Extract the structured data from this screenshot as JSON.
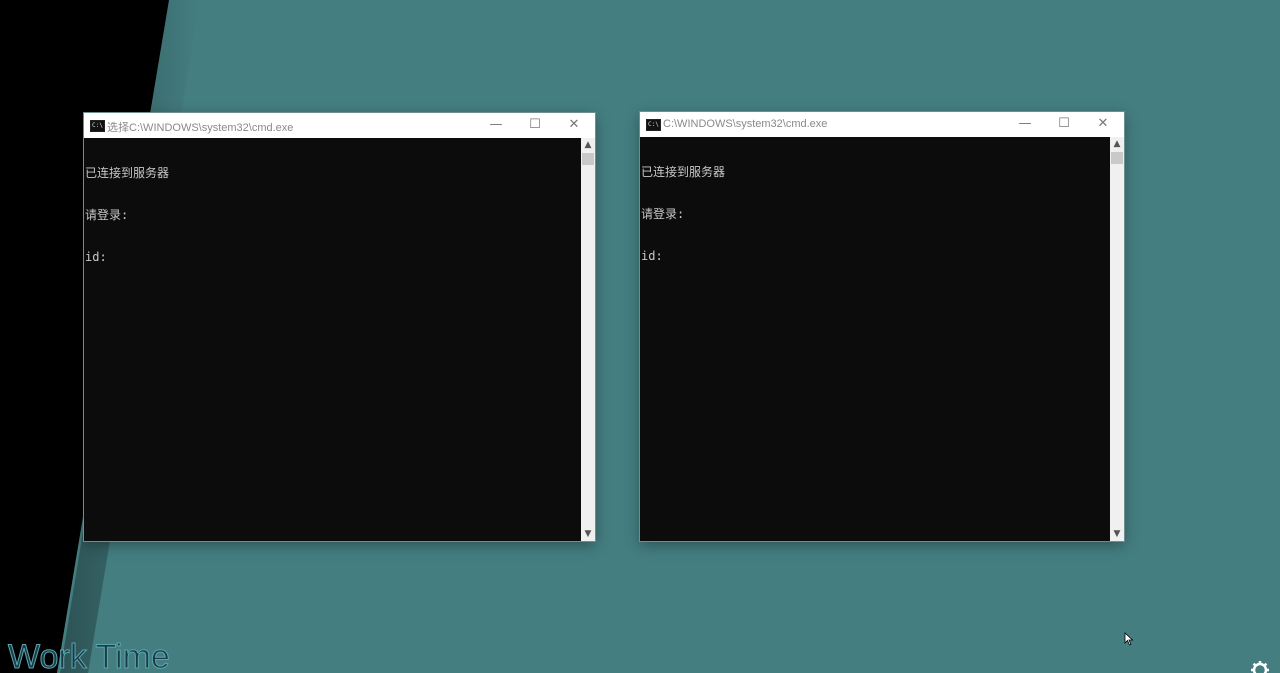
{
  "desktop": {
    "watermark_text": "Work Time",
    "background_color": "#447e81"
  },
  "windows": [
    {
      "title": "选择C:\\WINDOWS\\system32\\cmd.exe",
      "lines": [
        "已连接到服务器",
        "请登录:",
        "id:"
      ]
    },
    {
      "title": "C:\\WINDOWS\\system32\\cmd.exe",
      "lines": [
        "已连接到服务器",
        "请登录:",
        "id:"
      ]
    }
  ],
  "titlebar_buttons": {
    "minimize": "—",
    "maximize": "☐",
    "close": "✕"
  },
  "scrollbar": {
    "up_arrow": "▲",
    "down_arrow": "▼"
  },
  "icons": {
    "app_icon": "cmd-icon",
    "cursor": "mouse-cursor-icon",
    "settings": "gear-icon"
  }
}
